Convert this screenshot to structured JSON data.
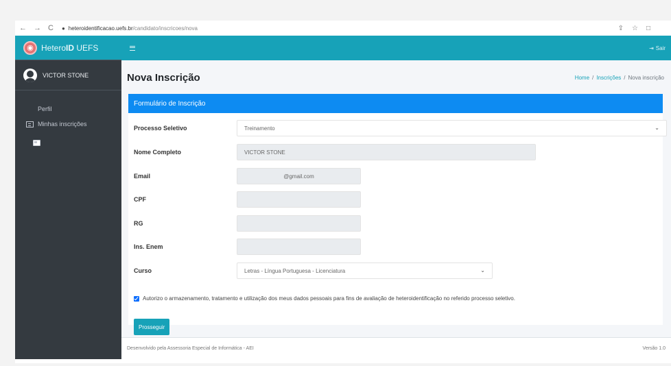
{
  "browser": {
    "nav_back": "←",
    "nav_forward": "→",
    "nav_reload": "C",
    "url_host": "heteroidentificacao.uefs.br",
    "url_path": "/candidato/inscricoes/nova",
    "icons_right": [
      "share-icon",
      "star-icon",
      "window-icon"
    ]
  },
  "brand": {
    "logo_glyph": "◉",
    "name_light": "Hetero",
    "name_bold": "ID",
    "name_suffix": " UEFS"
  },
  "user": {
    "name": "VICTOR STONE"
  },
  "sidebar": {
    "items": [
      {
        "label": "Perfil",
        "icon": "id-card-icon"
      },
      {
        "label": "Minhas inscrições",
        "icon": "list-icon"
      }
    ]
  },
  "topbar": {
    "logout_label": "Sair"
  },
  "header": {
    "title": "Nova Inscrição",
    "breadcrumb": [
      "Home",
      "Inscrições",
      "Nova inscrição"
    ]
  },
  "form": {
    "card_title": "Formulário de Inscrição",
    "fields": [
      {
        "label": "Processo Seletivo",
        "value": "Treinamento"
      },
      {
        "label": "Nome Completo",
        "value": "VICTOR STONE"
      },
      {
        "label": "Email",
        "value": "@gmail.com"
      },
      {
        "label": "CPF",
        "value": ""
      },
      {
        "label": "RG",
        "value": ""
      },
      {
        "label": "Ins. Enem",
        "value": ""
      },
      {
        "label": "Curso",
        "value": "Letras - Língua Portuguesa - Licenciatura"
      }
    ],
    "consent_text": "Autorizo o armazenamento, tratamento e utilização dos meus dados pessoais para fins de avaliação de heteroidentificação no referido processo seletivo.",
    "consent_checked": true,
    "submit_label": "Prosseguir",
    "colors": {
      "header": "#0d8bf2",
      "button": "#17a2b8"
    }
  },
  "footer": {
    "credit": "Desenvolvido pela Assessoria Especial de Informática - AEI",
    "version": "Versão 1.0"
  }
}
